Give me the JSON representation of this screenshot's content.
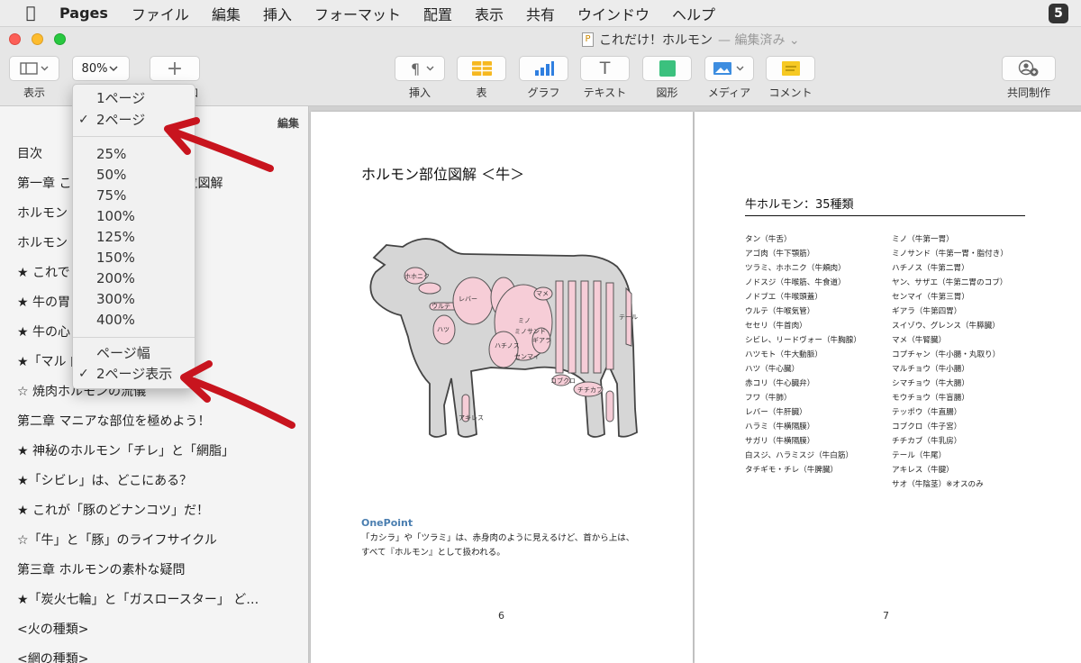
{
  "menubar": {
    "app": "Pages",
    "items": [
      "ファイル",
      "編集",
      "挿入",
      "フォーマット",
      "配置",
      "表示",
      "共有",
      "ウインドウ",
      "ヘルプ"
    ],
    "right_badge": "5"
  },
  "window": {
    "title": "これだけ！ホルモン",
    "edited": "— 編集済み ⌄"
  },
  "toolbar": {
    "view_label": "表示",
    "zoom_value": "80%",
    "add_label": "追加",
    "insert_label": "挿入",
    "table_label": "表",
    "chart_label": "グラフ",
    "text_label": "テキスト",
    "shape_label": "図形",
    "media_label": "メディア",
    "comment_label": "コメント",
    "collab_label": "共同制作"
  },
  "sidebar": {
    "edit_label": "編集",
    "items": [
      "目次",
      "第一章 これだけ！ホルモン部位図解",
      "ホルモン",
      "ホルモン",
      "★ これで      と「サガリ」",
      "★ 牛の胃",
      "★ 牛の心",
      "★「マル                    肉",
      "☆ 焼肉ホルモンの流儀",
      "第二章 マニアな部位を極めよう！",
      "★ 神秘のホルモン「チレ」と「網脂」",
      "★「シビレ」は、どこにある？",
      "★ これが「豚のどナンコツ」だ！",
      "☆「牛」と「豚」のライフサイクル",
      "第三章 ホルモンの素朴な疑問",
      "★「炭火七輪」と「ガスロースター」 ど…",
      "<火の種類>",
      "<網の種類>"
    ]
  },
  "zoom_menu": {
    "page_options": [
      {
        "label": "1ページ",
        "checked": false
      },
      {
        "label": "2ページ",
        "checked": true
      }
    ],
    "zoom_levels": [
      "25%",
      "50%",
      "75%",
      "100%",
      "125%",
      "150%",
      "200%",
      "300%",
      "400%"
    ],
    "fit_options": [
      {
        "label": "ページ幅",
        "checked": false
      },
      {
        "label": "2ページ表示",
        "checked": true
      }
    ]
  },
  "page_left": {
    "heading": "ホルモン部位図解 ＜牛＞",
    "diagram_labels": [
      "ミノ",
      "レバー",
      "ハツ",
      "マメ",
      "チチカブ",
      "ハチノス",
      "センマイ",
      "ギアラ",
      "コブクロ",
      "ミノサンド",
      "ホホニク",
      "ウルテ",
      "アキレス",
      "テール"
    ],
    "onepoint_title": "OnePoint",
    "onepoint_lines": [
      "「カシラ」や「ツラミ」は、赤身肉のように見えるけど、首から上は、",
      "すべて『ホルモン』として扱われる。"
    ],
    "page_number": "6"
  },
  "page_right": {
    "title": "牛ホルモン：35種類",
    "col1": [
      "タン（牛舌）",
      "アゴ肉（牛下顎筋）",
      "ツラミ、ホホニク（牛頬肉）",
      "ノドスジ（牛喉筋、牛食道）",
      "ノドブエ（牛喉頭蓋）",
      "ウルテ（牛喉気管）",
      "セセリ（牛首肉）",
      "シビレ、リードヴォー（牛胸腺）",
      "ハツモト（牛大動脈）",
      "ハツ（牛心臓）",
      "赤コリ（牛心臓弁）",
      "フワ（牛肺）",
      "レバー（牛肝臓）",
      "ハラミ（牛横隔膜）",
      "サガリ（牛横隔膜）",
      "白スジ、ハラミスジ（牛白筋）",
      "タチギモ・チレ（牛脾臓）"
    ],
    "col2": [
      "ミノ（牛第一胃）",
      "ミノサンド（牛第一胃・脂付き）",
      "ハチノス（牛第二胃）",
      "ヤン、サザエ（牛第二胃のコブ）",
      "センマイ（牛第三胃）",
      "ギアラ（牛第四胃）",
      "スイゾウ、グレンス（牛膵臓）",
      "マメ（牛腎臓）",
      "コプチャン（牛小腸・丸取り）",
      "マルチョウ（牛小腸）",
      "シマチョウ（牛大腸）",
      "モウチョウ（牛盲腸）",
      "テッポウ（牛直腸）",
      "コブクロ（牛子宮）",
      "チチカブ（牛乳房）",
      "テール（牛尾）",
      "アキレス（牛腱）",
      "サオ（牛陰茎）※オスのみ"
    ],
    "page_number": "7"
  },
  "colors": {
    "arrow": "#c8141e",
    "organ_fill": "#f6cdd7",
    "cow_fill": "#d6d6d6"
  }
}
